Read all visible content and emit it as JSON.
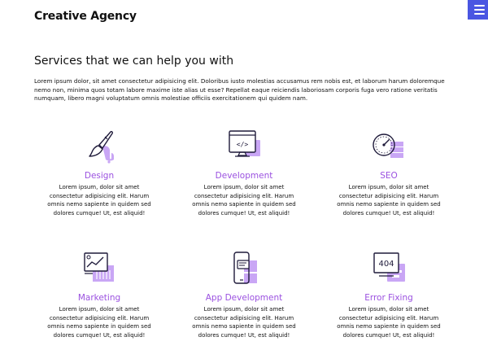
{
  "header": {
    "brand": "Creative Agency",
    "menu_icon": "hamburger-menu-icon"
  },
  "colors": {
    "accent": "#9b51e0",
    "menu_button": "#4a56e2",
    "icon_stroke": "#1e1a3a",
    "icon_fill": "#c9a6f5"
  },
  "main": {
    "title": "Services that we can help you with",
    "intro": "Lorem ipsum dolor, sit amet consectetur adipisicing elit. Doloribus iusto molestias accusamus rem nobis est, et laborum harum doloremque nemo non, minima quos totam labore maxime iste alias ut esse? Repellat eaque reiciendis laboriosam corporis fuga vero ratione veritatis numquam, libero magni voluptatum omnis molestiae officiis exercitationem qui quidem nam."
  },
  "services": [
    {
      "title": "Design",
      "icon": "paintbrush-icon",
      "desc": "Lorem ipsum, dolor sit amet consectetur adipisicing elit. Harum omnis nemo sapiente in quidem sed dolores cumque! Ut, est aliquid!"
    },
    {
      "title": "Development",
      "icon": "code-monitor-icon",
      "desc": "Lorem ipsum, dolor sit amet consectetur adipisicing elit. Harum omnis nemo sapiente in quidem sed dolores cumque! Ut, est aliquid!"
    },
    {
      "title": "SEO",
      "icon": "speedometer-icon",
      "desc": "Lorem ipsum, dolor sit amet consectetur adipisicing elit. Harum omnis nemo sapiente in quidem sed dolores cumque! Ut, est aliquid!"
    },
    {
      "title": "Marketing",
      "icon": "chart-presentation-icon",
      "desc": "Lorem ipsum, dolor sit amet consectetur adipisicing elit. Harum omnis nemo sapiente in quidem sed dolores cumque! Ut, est aliquid!"
    },
    {
      "title": "App Development",
      "icon": "mobile-app-icon",
      "desc": "Lorem ipsum, dolor sit amet consectetur adipisicing elit. Harum omnis nemo sapiente in quidem sed dolores cumque! Ut, est aliquid!"
    },
    {
      "title": "Error Fixing",
      "icon": "error-404-icon",
      "desc": "Lorem ipsum, dolor sit amet consectetur adipisicing elit. Harum omnis nemo sapiente in quidem sed dolores cumque! Ut, est aliquid!"
    }
  ],
  "icon_texts": {
    "code": "</>",
    "error": "404"
  }
}
